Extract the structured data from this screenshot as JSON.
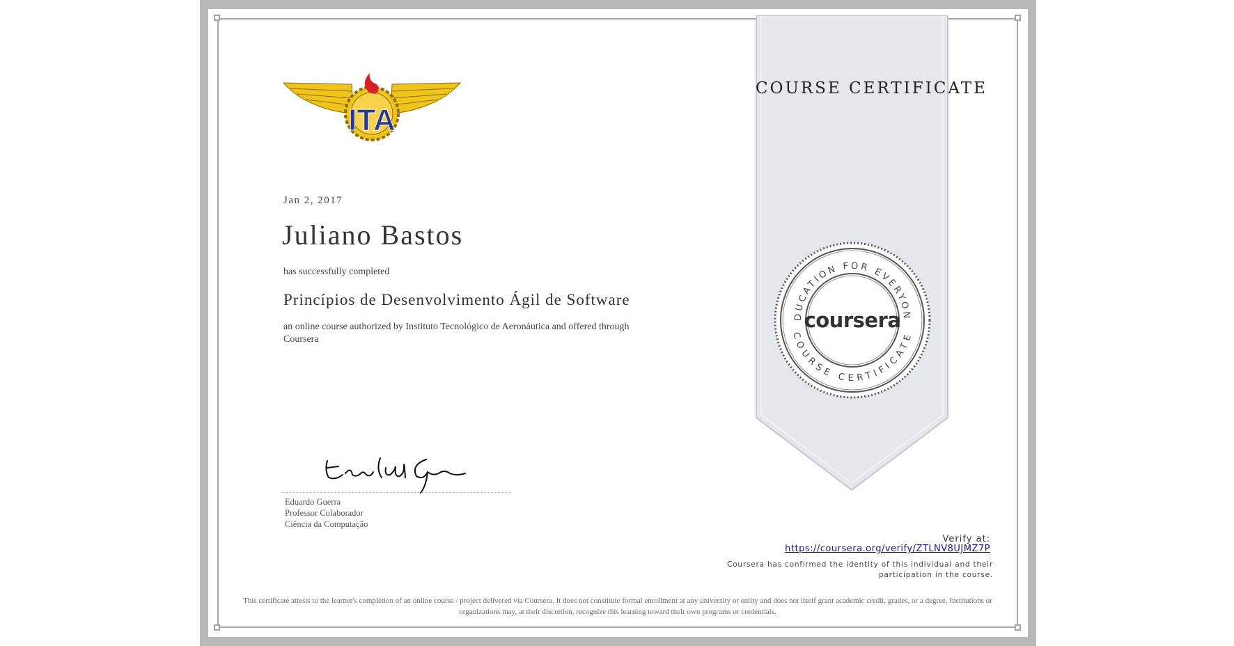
{
  "certificate": {
    "title": "COURSE CERTIFICATE",
    "date": "Jan 2, 2017",
    "recipient": "Juliano Bastos",
    "completed_text": "has successfully completed",
    "course_name": "Princípios de Desenvolvimento Ágil de Software",
    "authorization": "an online course authorized by Instituto Tecnológico de Aeronáutica and offered through Coursera"
  },
  "logo": {
    "text": "ITA",
    "name": "ita-winged-logo"
  },
  "seal": {
    "brand": "coursera",
    "ring_top": "EDUCATION FOR EVERYONE",
    "ring_bottom": "COURSE CERTIFICATE"
  },
  "signer": {
    "name": "Eduardo Guerra",
    "role": "Professor Colaborador",
    "department": "Ciência da Computação"
  },
  "verify": {
    "label": "Verify at:",
    "url": "https://coursera.org/verify/ZTLNV8UJMZ7P",
    "confirmation": "Coursera has confirmed the identity of this individual and their participation in the course."
  },
  "disclaimer": "This certificate attests to the learner's completion of an online course / project delivered via Coursera. It does not constitute formal enrollment at any university or entity and does not itself grant academic credit, grades, or a degree. Institutions or organizations may, at their discretion, recognize this learning toward their own programs or credentials.",
  "colors": {
    "ribbon": "#e4e7ec",
    "frame": "#a4a4a4",
    "outer": "#b9b9b9",
    "link": "#1a0dab",
    "logo_gold": "#f0c419",
    "logo_blue": "#2b3990",
    "logo_red": "#d92027"
  }
}
